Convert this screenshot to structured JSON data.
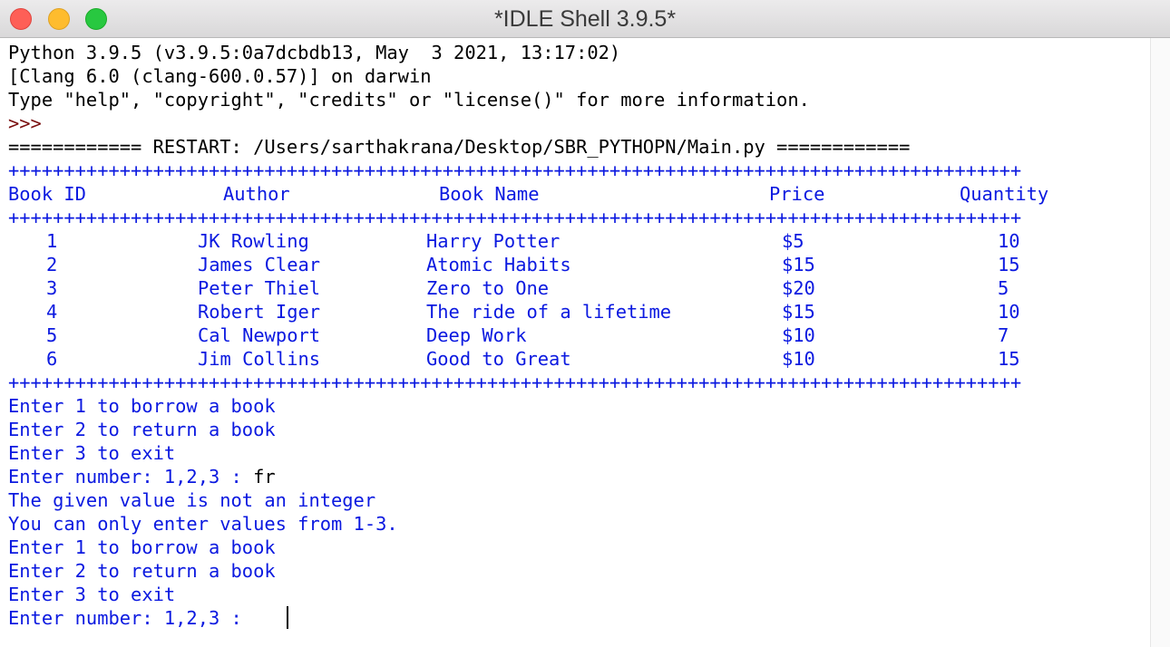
{
  "window": {
    "title": "*IDLE Shell 3.9.5*"
  },
  "banner": {
    "line1": "Python 3.9.5 (v3.9.5:0a7dcbdb13, May  3 2021, 13:17:02)",
    "line2": "[Clang 6.0 (clang-600.0.57)] on darwin",
    "line3": "Type \"help\", \"copyright\", \"credits\" or \"license()\" for more information.",
    "prompt": ">>>",
    "restart": "============ RESTART: /Users/sarthakrana/Desktop/SBR_PYTHOPN/Main.py ============"
  },
  "table": {
    "separator": "+++++++++++++++++++++++++++++++++++++++++++++++++++++++++++++++++++++++++++++++++++++++++++",
    "headers": [
      "Book ID",
      "Author",
      "Book Name",
      "Price",
      "Quantity"
    ],
    "rows": [
      [
        "1",
        "JK Rowling",
        "Harry Potter",
        "$5",
        "10"
      ],
      [
        "2",
        "James Clear",
        "Atomic Habits",
        "$15",
        "15"
      ],
      [
        "3",
        "Peter Thiel",
        "Zero to One",
        "$20",
        "5"
      ],
      [
        "4",
        "Robert Iger",
        "The ride of a lifetime",
        "$15",
        "10"
      ],
      [
        "5",
        "Cal Newport",
        "Deep Work",
        "$10",
        "7"
      ],
      [
        "6",
        "Jim Collins",
        "Good to Great",
        "$10",
        "15"
      ]
    ]
  },
  "session": {
    "menu1": [
      "Enter 1 to borrow a book",
      "Enter 2 to return a book",
      "Enter 3 to exit"
    ],
    "input_prompt_1": "Enter number: 1,2,3 : ",
    "user_input_1": "fr",
    "error1": "The given value is not an integer",
    "error2": "You can only enter values from 1-3.",
    "menu2": [
      "Enter 1 to borrow a book",
      "Enter 2 to return a book",
      "Enter 3 to exit"
    ],
    "input_prompt_2": "Enter number: 1,2,3 : ",
    "user_input_2": ""
  },
  "colors": {
    "output_blue": "#0b19e0",
    "stdin_black": "#000000",
    "prompt_red": "#7a0f0f"
  }
}
